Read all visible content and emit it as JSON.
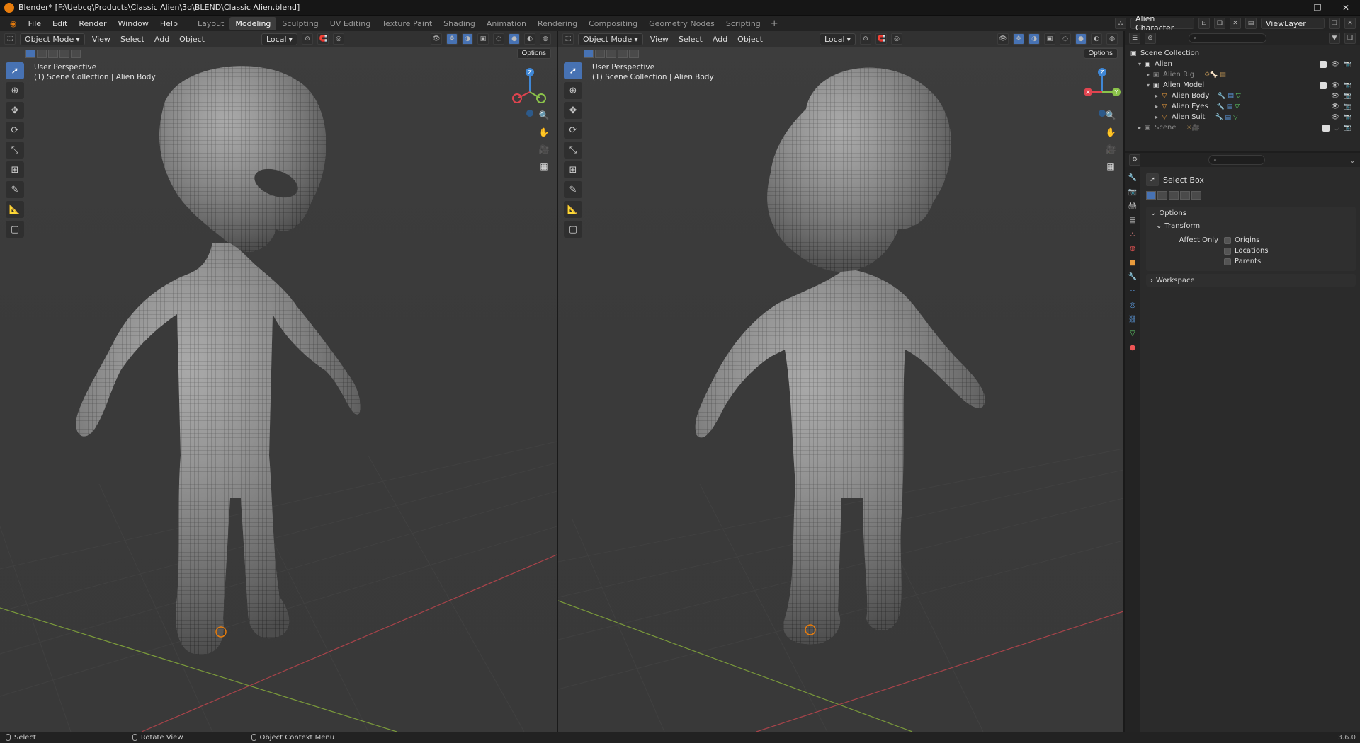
{
  "window": {
    "title": "Blender* [F:\\Uebcg\\Products\\Classic Alien\\3d\\BLEND\\Classic Alien.blend]"
  },
  "menu": [
    "File",
    "Edit",
    "Render",
    "Window",
    "Help"
  ],
  "workspaces": [
    "Layout",
    "Modeling",
    "Sculpting",
    "UV Editing",
    "Texture Paint",
    "Shading",
    "Animation",
    "Rendering",
    "Compositing",
    "Geometry Nodes",
    "Scripting"
  ],
  "active_workspace": "Modeling",
  "scene_name": "Alien Character",
  "view_layer": "ViewLayer",
  "viewport_left": {
    "mode": "Object Mode",
    "menus": [
      "View",
      "Select",
      "Add",
      "Object"
    ],
    "transform": "Local",
    "perspective": "User Perspective",
    "collection": "(1) Scene Collection | Alien Body",
    "options": "Options"
  },
  "viewport_right": {
    "mode": "Object Mode",
    "menus": [
      "View",
      "Select",
      "Add",
      "Object"
    ],
    "transform": "Local",
    "perspective": "User Perspective",
    "collection": "(1) Scene Collection | Alien Body",
    "options": "Options"
  },
  "gizmo": {
    "z": "Z",
    "y": "Y",
    "x": "X"
  },
  "outliner": {
    "root": "Scene Collection",
    "items": [
      {
        "label": "Alien",
        "level": 1
      },
      {
        "label": "Alien Rig",
        "level": 2
      },
      {
        "label": "Alien Model",
        "level": 2
      },
      {
        "label": "Alien Body",
        "level": 3
      },
      {
        "label": "Alien Eyes",
        "level": 3
      },
      {
        "label": "Alien Suit",
        "level": 3
      },
      {
        "label": "Scene",
        "level": 1
      }
    ]
  },
  "properties": {
    "tool": "Select Box",
    "options_panel": "Options",
    "transform_panel": "Transform",
    "affect_only": "Affect Only",
    "checks": [
      "Origins",
      "Locations",
      "Parents"
    ],
    "workspace_panel": "Workspace"
  },
  "status": {
    "select": "Select",
    "rotate": "Rotate View",
    "context": "Object Context Menu",
    "version": "3.6.0"
  },
  "colors": {
    "accent": "#4772b3",
    "x_axis": "#e0444f",
    "y_axis": "#8bc34a",
    "z_axis": "#3f87d6",
    "blender_orange": "#e87d0d"
  }
}
